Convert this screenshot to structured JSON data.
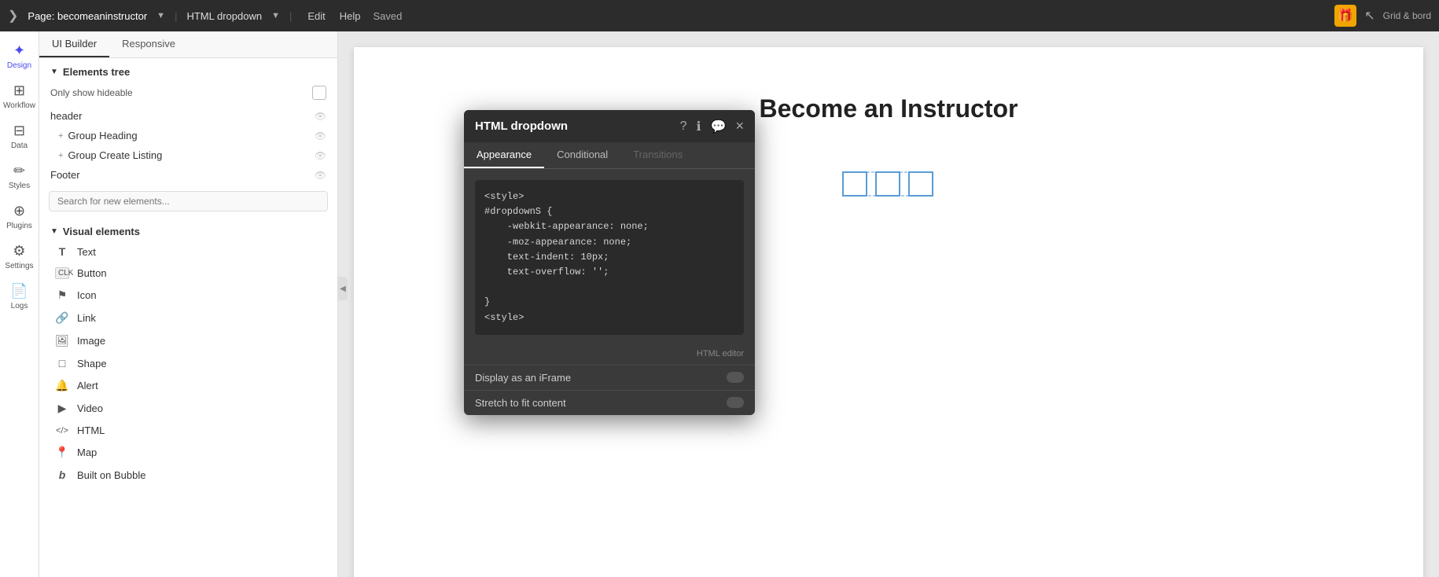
{
  "topbar": {
    "chevron": "❯",
    "page_label": "Page: becomeaninstructor",
    "dropdown_arrow": "▼",
    "html_dropdown_label": "HTML dropdown",
    "html_dropdown_arrow": "▼",
    "edit_label": "Edit",
    "help_label": "Help",
    "saved_label": "Saved",
    "gift_icon": "🎁",
    "grid_label": "Grid & bord"
  },
  "sidebar": {
    "items": [
      {
        "id": "design",
        "icon": "✦",
        "label": "Design",
        "active": true
      },
      {
        "id": "workflow",
        "icon": "⚙",
        "label": "Workflow"
      },
      {
        "id": "data",
        "icon": "🗄",
        "label": "Data"
      },
      {
        "id": "styles",
        "icon": "✏",
        "label": "Styles"
      },
      {
        "id": "plugins",
        "icon": "🔌",
        "label": "Plugins"
      },
      {
        "id": "settings",
        "icon": "⚙",
        "label": "Settings"
      },
      {
        "id": "logs",
        "icon": "📄",
        "label": "Logs"
      }
    ]
  },
  "panel": {
    "tabs": [
      {
        "id": "ui-builder",
        "label": "UI Builder",
        "active": true
      },
      {
        "id": "responsive",
        "label": "Responsive",
        "active": false
      }
    ],
    "elements_tree_label": "Elements tree",
    "show_hideable_label": "Only show hideable",
    "tree_items": [
      {
        "id": "header",
        "label": "header",
        "indent": 0
      },
      {
        "id": "group-heading",
        "label": "Group Heading",
        "indent": 1,
        "has_plus": true
      },
      {
        "id": "group-create",
        "label": "Group Create Listing",
        "indent": 1,
        "has_plus": true
      },
      {
        "id": "footer",
        "label": "Footer",
        "indent": 0
      }
    ],
    "search_placeholder": "Search for new elements...",
    "visual_elements_label": "Visual elements",
    "elements": [
      {
        "id": "text",
        "icon": "T",
        "label": "Text"
      },
      {
        "id": "button",
        "icon": "▭",
        "label": "Button"
      },
      {
        "id": "icon",
        "icon": "⚑",
        "label": "Icon"
      },
      {
        "id": "link",
        "icon": "🔗",
        "label": "Link"
      },
      {
        "id": "image",
        "icon": "🖼",
        "label": "Image"
      },
      {
        "id": "shape",
        "icon": "□",
        "label": "Shape"
      },
      {
        "id": "alert",
        "icon": "🔔",
        "label": "Alert"
      },
      {
        "id": "video",
        "icon": "▶",
        "label": "Video"
      },
      {
        "id": "html",
        "icon": "</>",
        "label": "HTML"
      },
      {
        "id": "map",
        "icon": "📍",
        "label": "Map"
      },
      {
        "id": "built-on-bubble",
        "icon": "b",
        "label": "Built on Bubble"
      }
    ]
  },
  "canvas": {
    "page_title": "Become an Instructor"
  },
  "modal": {
    "title": "HTML dropdown",
    "icons": [
      "?",
      "ℹ",
      "💬"
    ],
    "close": "×",
    "tabs": [
      {
        "id": "appearance",
        "label": "Appearance",
        "active": true
      },
      {
        "id": "conditional",
        "label": "Conditional",
        "active": false
      },
      {
        "id": "transitions",
        "label": "Transitions",
        "active": false,
        "disabled": true
      }
    ],
    "code": "<style>\n#dropdownS {\n    -webkit-appearance: none;\n    -moz-appearance: none;\n    text-indent: 10px;\n    text-overflow: '';\n\n}\n<style>",
    "editor_label": "HTML editor",
    "options": [
      {
        "id": "display-iframe",
        "label": "Display as an iFrame"
      },
      {
        "id": "stretch-fit",
        "label": "Stretch to fit content"
      }
    ]
  }
}
